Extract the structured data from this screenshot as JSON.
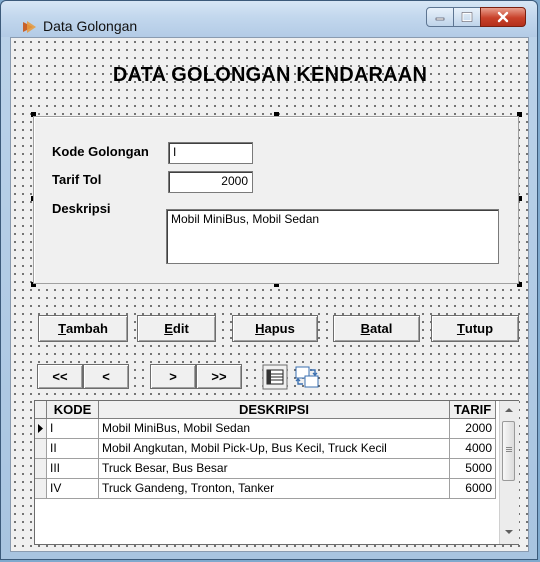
{
  "window": {
    "title": "Data Golongan",
    "heading": "DATA GOLONGAN KENDARAAN"
  },
  "form": {
    "kode_label": "Kode Golongan",
    "kode_value": "I",
    "tarif_label": "Tarif Tol",
    "tarif_value": "2000",
    "deskripsi_label": "Deskripsi",
    "deskripsi_value": "Mobil MiniBus, Mobil Sedan"
  },
  "buttons": {
    "tambah": {
      "first": "T",
      "rest": "ambah"
    },
    "edit": {
      "first": "E",
      "rest": "dit"
    },
    "hapus": {
      "first": "H",
      "rest": "apus"
    },
    "batal": {
      "first": "B",
      "rest": "atal"
    },
    "tutup": {
      "first": "T",
      "rest": "utup"
    }
  },
  "nav": {
    "first": "<<",
    "prev": "<",
    "next": ">",
    "last": ">>"
  },
  "grid": {
    "columns": [
      "KODE",
      "DESKRIPSI",
      "TARIF"
    ],
    "rows": [
      {
        "kode": "I",
        "deskripsi": "Mobil MiniBus, Mobil Sedan",
        "tarif": "2000"
      },
      {
        "kode": "II",
        "deskripsi": "Mobil Angkutan, Mobil Pick-Up, Bus Kecil, Truck Kecil",
        "tarif": "4000"
      },
      {
        "kode": "III",
        "deskripsi": "Truck Besar, Bus Besar",
        "tarif": "5000"
      },
      {
        "kode": "IV",
        "deskripsi": "Truck Gandeng, Tronton, Tanker",
        "tarif": "6000"
      }
    ]
  },
  "colors": {
    "close_button": "#c8412a",
    "titlebar": "#c2d7ed",
    "form_background": "#f0f0f0"
  }
}
